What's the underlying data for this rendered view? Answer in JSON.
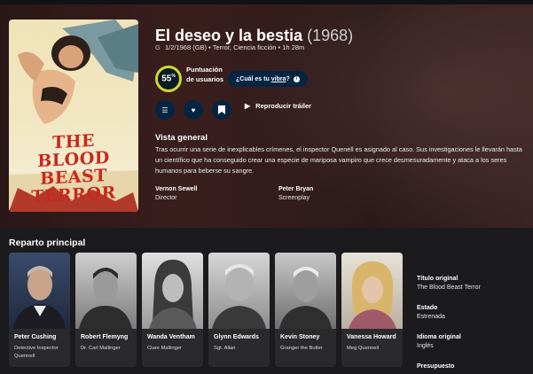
{
  "movie": {
    "title": "El deseo y la bestia",
    "year": "(1968)",
    "certification": "G",
    "release": "1/2/1968 (GB)",
    "genres": "Terror, Ciencia ficción",
    "runtime": "1h 28m",
    "bullet": "•"
  },
  "poster": {
    "title_line1": "THE",
    "title_line2": "BLOOD BEAST",
    "title_line3": "TERROR"
  },
  "score": {
    "value": "55",
    "unit": "%",
    "label": "Puntuación de usuarios",
    "ring_fraction": 0.55,
    "ring_color": "#d2d531"
  },
  "vibe": {
    "prefix": "¿Cuál es tu",
    "link": "vibra",
    "suffix": "?",
    "info": "i"
  },
  "actions": {
    "list_icon": "☰",
    "favorite_icon": "♥",
    "watchlist_icon": "🔖",
    "play_icon": "▶",
    "trailer_label": "Reproducir tráiler"
  },
  "overview": {
    "heading": "Vista general",
    "text": "Tras ocurrir una serie de inexplicables crímenes, el inspector Quenell es asignado al caso. Sus investigaciones le llevarán hasta un científico que ha conseguido crear una especie de mariposa vampiro que crece desmesuradamente y ataca a los seres humanos para beberse su sangre."
  },
  "crew": [
    {
      "name": "Vernon Sewell",
      "role": "Director"
    },
    {
      "name": "Peter Bryan",
      "role": "Screenplay"
    }
  ],
  "cast_heading": "Reparto principal",
  "cast": [
    {
      "name": "Peter Cushing",
      "character": "Detective Inspector Quennell"
    },
    {
      "name": "Robert Flemyng",
      "character": "Dr. Carl Mallinger"
    },
    {
      "name": "Wanda Ventham",
      "character": "Clare Mallinger"
    },
    {
      "name": "Glynn Edwards",
      "character": "Sgt. Allan"
    },
    {
      "name": "Kevin Stoney",
      "character": "Granger the Butler"
    },
    {
      "name": "Vanessa Howard",
      "character": "Meg Quennell"
    }
  ],
  "sidebar": [
    {
      "label": "Título original",
      "value": "The Blood Beast Terror"
    },
    {
      "label": "Estado",
      "value": "Estrenada"
    },
    {
      "label": "Idioma original",
      "value": "Inglés"
    },
    {
      "label": "Presupuesto",
      "value": ""
    }
  ]
}
